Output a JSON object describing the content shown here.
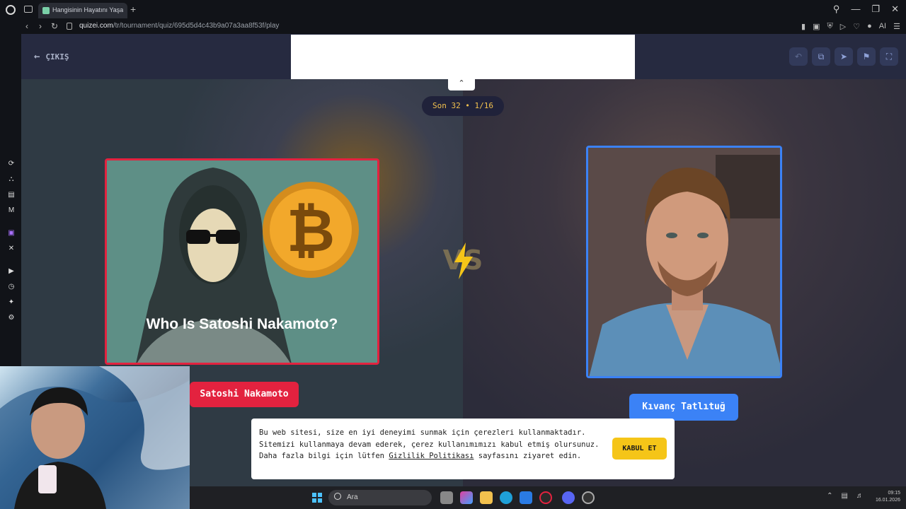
{
  "browser": {
    "tab_title": "Hangisinin Hayatını Yaşam",
    "new_tab": "+",
    "url_host": "quizei.com",
    "url_path": "/tr/tournament/quiz/695d5d4c43b9a07a3aa8f53f/play",
    "ai_label": "AI"
  },
  "page": {
    "exit_label": "ÇIKIŞ",
    "round_label": "Son 32 • 1/16",
    "left_card": {
      "caption": "Who Is Satoshi Nakamoto?",
      "name": "Satoshi Nakamoto",
      "accent": "#e3223f"
    },
    "right_card": {
      "name": "Kıvanç Tatlıtuğ",
      "accent": "#3b82f6"
    },
    "vs_label": "VS",
    "toolbar_icons": [
      "undo-icon",
      "share-icon",
      "send-icon",
      "flag-icon",
      "fullscreen-icon"
    ]
  },
  "cookie": {
    "text_before": "Bu web sitesi, size en iyi deneyimi sunmak için çerezleri kullanmaktadır. Sitemizi kullanmaya devam ederek, çerez kullanımımızı kabul etmiş olursunuz. Daha fazla bilgi için lütfen ",
    "link": "Gizlilik Politikası",
    "text_after": " sayfasını ziyaret edin.",
    "accept": "KABUL ET"
  },
  "taskbar": {
    "search_placeholder": "Ara",
    "time": "09:15",
    "date": "16.01.2026"
  }
}
